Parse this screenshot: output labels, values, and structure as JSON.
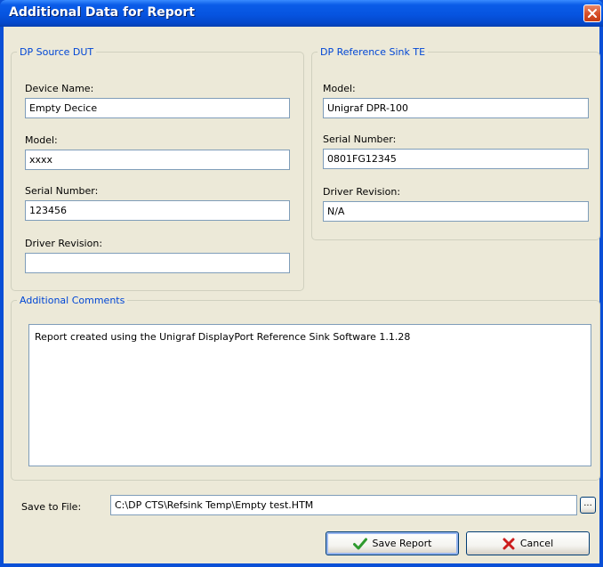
{
  "window": {
    "title": "Additional Data for Report"
  },
  "source_dut": {
    "legend": "DP Source DUT",
    "device_name_label": "Device Name:",
    "device_name_value": "Empty Decice",
    "model_label": "Model:",
    "model_value": "xxxx",
    "serial_label": "Serial Number:",
    "serial_value": "123456",
    "driver_label": "Driver Revision:",
    "driver_value": ""
  },
  "reference_sink": {
    "legend": "DP Reference Sink TE",
    "model_label": "Model:",
    "model_value": "Unigraf DPR-100",
    "serial_label": "Serial Number:",
    "serial_value": "0801FG12345",
    "driver_label": "Driver Revision:",
    "driver_value": "N/A"
  },
  "comments": {
    "legend": "Additional Comments",
    "text": "Report created using the Unigraf DisplayPort Reference Sink Software 1.1.28"
  },
  "save_to_file": {
    "label": "Save to File:",
    "path": "C:\\DP CTS\\Refsink Temp\\Empty test.HTM",
    "browse_label": "..."
  },
  "buttons": {
    "save_label": "Save Report",
    "cancel_label": "Cancel"
  },
  "icons": {
    "close": "close-icon",
    "save": "checkmark-icon",
    "cancel": "red-x-icon"
  },
  "colors": {
    "title_bar": "#0654e0",
    "group_legend": "#0046d5",
    "dialog_bg": "#ece9d8",
    "close_button": "#d8512b",
    "check_green": "#2e9a2e",
    "cancel_red": "#cc1d1d"
  }
}
